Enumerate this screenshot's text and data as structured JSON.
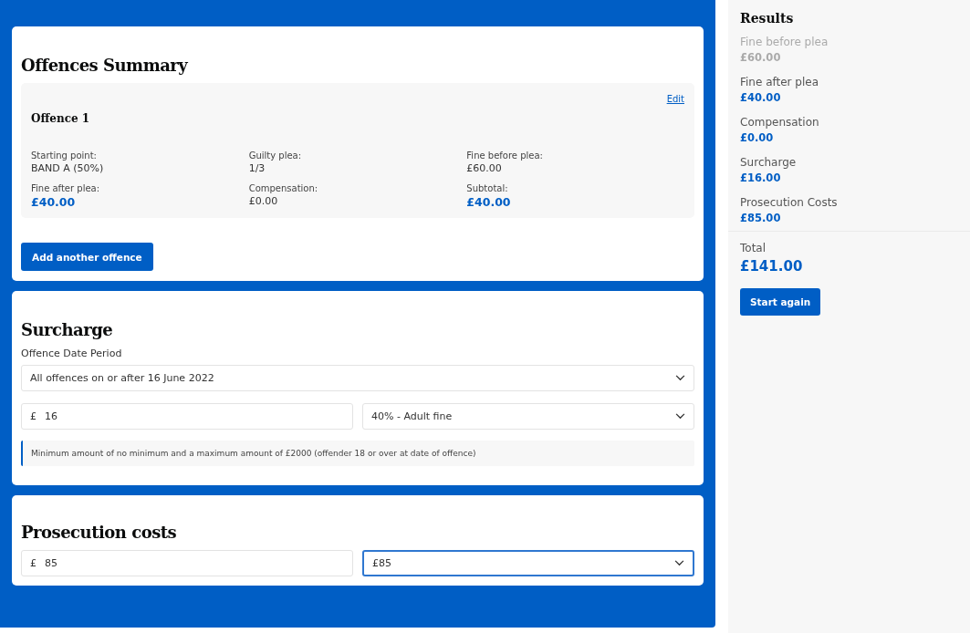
{
  "offences_summary": {
    "title": "Offences Summary",
    "offences": [
      {
        "title": "Offence 1",
        "edit_link": "Edit",
        "fields": [
          {
            "label": "Starting point:",
            "value": "BAND A (50%)",
            "emphasis": false
          },
          {
            "label": "Guilty plea:",
            "value": "1/3",
            "emphasis": false
          },
          {
            "label": "Fine before plea:",
            "value": "£60.00",
            "emphasis": false
          },
          {
            "label": "Fine after plea:",
            "value": "£40.00",
            "emphasis": true
          },
          {
            "label": "Compensation:",
            "value": "£0.00",
            "emphasis": false
          },
          {
            "label": "Subtotal:",
            "value": "£40.00",
            "emphasis": true
          }
        ]
      }
    ],
    "add_button": "Add another offence"
  },
  "surcharge": {
    "title": "Surcharge",
    "period_label": "Offence Date Period",
    "period_select": {
      "value": "All offences on or after 16 June 2022",
      "focused": false
    },
    "amount_field": {
      "prefix": "£",
      "value": "16"
    },
    "rate_select": {
      "value": "40% - Adult fine",
      "focused": false
    },
    "note": "Minimum amount of no minimum and a maximum amount of £2000 (offender 18 or over at date of offence)"
  },
  "prosecution_costs": {
    "title": "Prosecution costs",
    "amount_field": {
      "prefix": "£",
      "value": "85"
    },
    "select": {
      "value": "£85",
      "focused": true
    }
  },
  "results": {
    "title": "Results",
    "items": [
      {
        "label": "Fine before plea",
        "value": "£60.00",
        "disabled": true
      },
      {
        "label": "Fine after plea",
        "value": "£40.00",
        "disabled": false
      },
      {
        "label": "Compensation",
        "value": "£0.00",
        "disabled": false
      },
      {
        "label": "Surcharge",
        "value": "£16.00",
        "disabled": false
      },
      {
        "label": "Prosecution Costs",
        "value": "£85.00",
        "disabled": false
      }
    ],
    "total_label": "Total",
    "total_value": "£141.00",
    "start_again_button": "Start again"
  }
}
